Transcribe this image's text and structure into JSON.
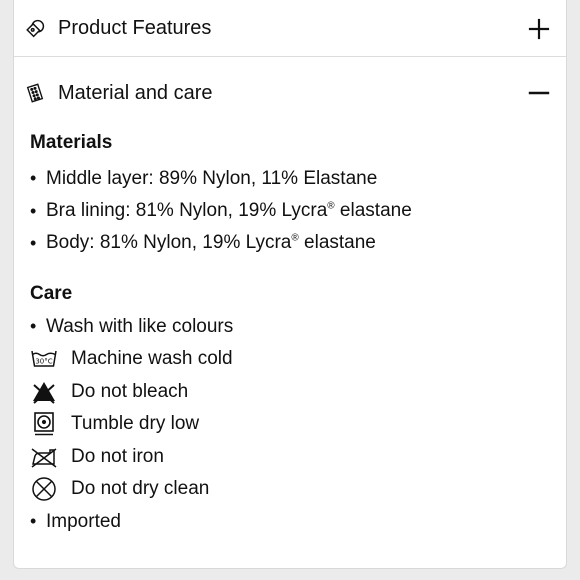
{
  "accordion": {
    "product_features": {
      "title": "Product Features",
      "icon": "tag-icon",
      "toggle_icon": "plus-icon",
      "expanded": false
    },
    "material_care": {
      "title": "Material and care",
      "icon": "fabric-swatch-icon",
      "toggle_icon": "minus-icon",
      "expanded": true,
      "materials": {
        "heading": "Materials",
        "items": [
          "Middle layer: 89% Nylon, 11% Elastane",
          "Bra lining: 81% Nylon, 19% Lycra® elastane",
          "Body: 81% Nylon, 19% Lycra® elastane"
        ]
      },
      "care": {
        "heading": "Care",
        "intro": "Wash with like colours",
        "instructions": [
          {
            "icon": "wash-30c-icon",
            "symbol_text": "30°C",
            "label": "Machine wash cold"
          },
          {
            "icon": "do-not-bleach-icon",
            "label": "Do not bleach"
          },
          {
            "icon": "tumble-dry-low-icon",
            "label": "Tumble dry low"
          },
          {
            "icon": "do-not-iron-icon",
            "label": "Do not iron"
          },
          {
            "icon": "do-not-dry-clean-icon",
            "label": "Do not dry clean"
          }
        ],
        "footer": "Imported"
      }
    }
  }
}
